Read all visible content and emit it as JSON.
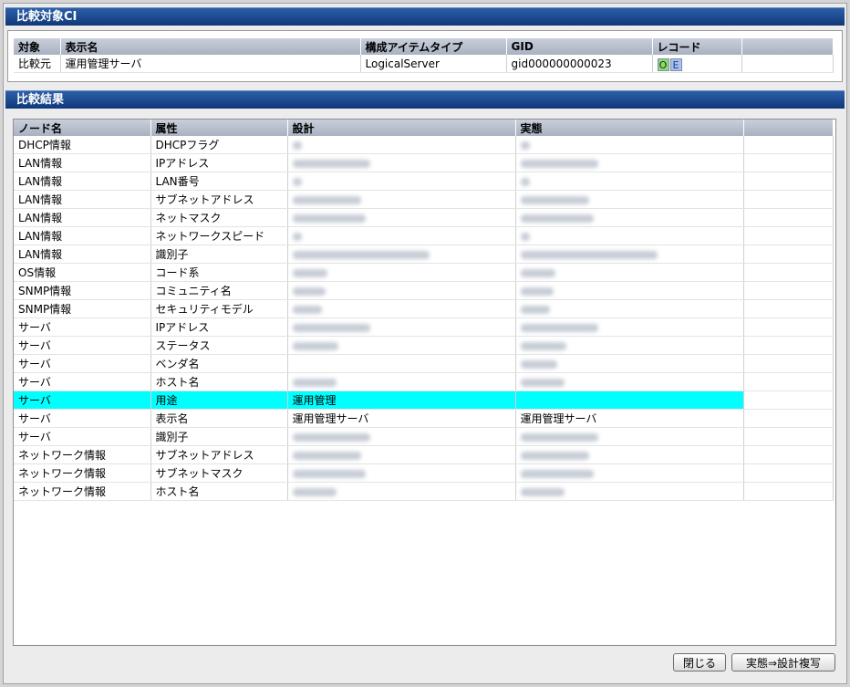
{
  "ci_panel": {
    "title": "比較対象CI",
    "columns": [
      "対象",
      "表示名",
      "構成アイテムタイプ",
      "GID",
      "レコード"
    ],
    "row": {
      "target": "比較元",
      "display_name": "運用管理サーバ",
      "item_type": "LogicalServer",
      "gid": "gid000000000023",
      "record_o": "O",
      "record_e": "E"
    }
  },
  "result_panel": {
    "title": "比較結果",
    "columns": [
      "ノード名",
      "属性",
      "設計",
      "実態"
    ],
    "rows": [
      {
        "node": "DHCP情報",
        "attr": "DHCPフラグ",
        "design_blur": 10,
        "actual_blur": 10,
        "highlight": false
      },
      {
        "node": "LAN情報",
        "attr": "IPアドレス",
        "design_blur": 85,
        "actual_blur": 85,
        "highlight": false
      },
      {
        "node": "LAN情報",
        "attr": "LAN番号",
        "design_blur": 10,
        "actual_blur": 10,
        "highlight": false
      },
      {
        "node": "LAN情報",
        "attr": "サブネットアドレス",
        "design_blur": 75,
        "actual_blur": 75,
        "highlight": false
      },
      {
        "node": "LAN情報",
        "attr": "ネットマスク",
        "design_blur": 80,
        "actual_blur": 80,
        "highlight": false
      },
      {
        "node": "LAN情報",
        "attr": "ネットワークスピード",
        "design_blur": 10,
        "actual_blur": 10,
        "highlight": false
      },
      {
        "node": "LAN情報",
        "attr": "識別子",
        "design_blur": 150,
        "actual_blur": 150,
        "highlight": false
      },
      {
        "node": "OS情報",
        "attr": "コード系",
        "design_blur": 38,
        "actual_blur": 38,
        "highlight": false
      },
      {
        "node": "SNMP情報",
        "attr": "コミュニティ名",
        "design_blur": 36,
        "actual_blur": 36,
        "highlight": false
      },
      {
        "node": "SNMP情報",
        "attr": "セキュリティモデル",
        "design_blur": 32,
        "actual_blur": 32,
        "highlight": false
      },
      {
        "node": "サーバ",
        "attr": "IPアドレス",
        "design_blur": 85,
        "actual_blur": 85,
        "highlight": false
      },
      {
        "node": "サーバ",
        "attr": "ステータス",
        "design_blur": 50,
        "actual_blur": 50,
        "highlight": false
      },
      {
        "node": "サーバ",
        "attr": "ベンダ名",
        "design_blur": 0,
        "actual_blur": 40,
        "highlight": false
      },
      {
        "node": "サーバ",
        "attr": "ホスト名",
        "design_blur": 48,
        "actual_blur": 48,
        "highlight": false
      },
      {
        "node": "サーバ",
        "attr": "用途",
        "design": "運用管理",
        "design_blur": 0,
        "actual_blur": 0,
        "highlight": true
      },
      {
        "node": "サーバ",
        "attr": "表示名",
        "design": "運用管理サーバ",
        "actual": "運用管理サーバ",
        "design_blur": 0,
        "actual_blur": 0,
        "highlight": false
      },
      {
        "node": "サーバ",
        "attr": "識別子",
        "design_blur": 85,
        "actual_blur": 85,
        "highlight": false
      },
      {
        "node": "ネットワーク情報",
        "attr": "サブネットアドレス",
        "design_blur": 75,
        "actual_blur": 75,
        "highlight": false
      },
      {
        "node": "ネットワーク情報",
        "attr": "サブネットマスク",
        "design_blur": 80,
        "actual_blur": 80,
        "highlight": false
      },
      {
        "node": "ネットワーク情報",
        "attr": "ホスト名",
        "design_blur": 48,
        "actual_blur": 48,
        "highlight": false
      }
    ]
  },
  "buttons": {
    "close": "閉じる",
    "copy": "実態⇒設計複写"
  },
  "colors": {
    "header_blue": "#1a4a92",
    "highlight": "#00ffff",
    "record_o": "#8fd874",
    "record_e": "#a9bff0"
  }
}
